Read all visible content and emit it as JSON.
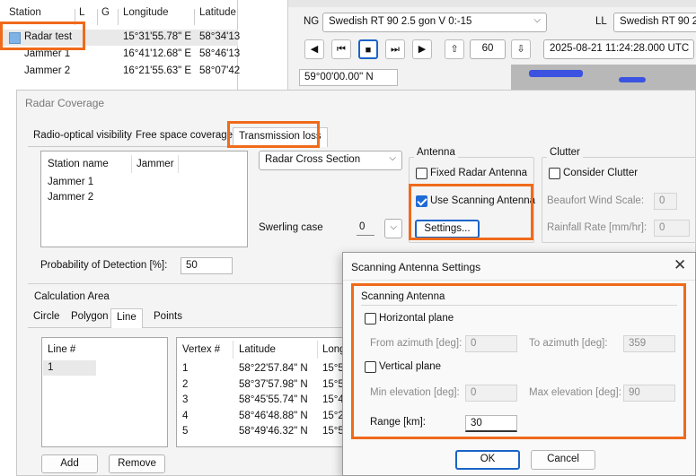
{
  "station_table": {
    "headers": [
      "Station",
      "L",
      "G",
      "Longitude",
      "Latitude"
    ],
    "rows": [
      {
        "name": "Radar test",
        "longitude": "15°31'55.78\" E",
        "latitude": "58°34'13"
      },
      {
        "name": "Jammer 1",
        "longitude": "16°41'12.68\" E",
        "latitude": "58°46'13"
      },
      {
        "name": "Jammer 2",
        "longitude": "16°21'55.63\" E",
        "latitude": "58°07'42"
      }
    ]
  },
  "map_toolbar": {
    "ng_label": "NG",
    "ng_value": "Swedish RT 90 2.5 gon V 0:-15",
    "ll_label": "LL",
    "ll_value": "Swedish RT 90 2.5",
    "step_value": "60",
    "datetime": "2025-08-21 11:24:28.000 UTC",
    "coord_readout": "59°00'00.00\" N"
  },
  "radar_coverage": {
    "title": "Radar Coverage",
    "tabs": [
      "Radio-optical visibility",
      "Free space coverage",
      "Transmission loss"
    ],
    "station_list_headers": [
      "Station name",
      "Jammer"
    ],
    "station_list_items": [
      "Jammer 1",
      "Jammer 2"
    ],
    "rcs_select": "Radar Cross Section",
    "swerling_label": "Swerling case",
    "swerling_value": "0",
    "pod_label": "Probability of Detection [%]:",
    "pod_value": "50",
    "antenna": {
      "title": "Antenna",
      "fixed_label": "Fixed Radar Antenna",
      "scanning_label": "Use Scanning Antenna",
      "settings_label": "Settings..."
    },
    "clutter": {
      "title": "Clutter",
      "consider_label": "Consider Clutter",
      "beaufort_label": "Beaufort Wind Scale:",
      "beaufort_value": "0",
      "rainfall_label": "Rainfall Rate [mm/hr]:",
      "rainfall_value": "0"
    },
    "calc_area": {
      "title": "Calculation Area",
      "tabs": [
        "Circle",
        "Polygon",
        "Line",
        "Points"
      ],
      "line_header": "Line #",
      "line_items": [
        "1"
      ],
      "vertex_headers": [
        "Vertex #",
        "Latitude",
        "Long"
      ],
      "vertices": [
        {
          "n": "1",
          "lat": "58°22'57.84\" N",
          "lon": "15°5"
        },
        {
          "n": "2",
          "lat": "58°37'57.98\" N",
          "lon": "15°5"
        },
        {
          "n": "3",
          "lat": "58°45'55.74\" N",
          "lon": "15°4"
        },
        {
          "n": "4",
          "lat": "58°46'48.88\" N",
          "lon": "15°2"
        },
        {
          "n": "5",
          "lat": "58°49'46.32\" N",
          "lon": "15°5"
        }
      ],
      "add_label": "Add",
      "remove_label": "Remove"
    }
  },
  "scan_dialog": {
    "title": "Scanning Antenna Settings",
    "group_title": "Scanning Antenna",
    "horizontal_label": "Horizontal plane",
    "from_az_label": "From azimuth [deg]:",
    "from_az_value": "0",
    "to_az_label": "To azimuth [deg]:",
    "to_az_value": "359",
    "vertical_label": "Vertical plane",
    "min_el_label": "Min elevation [deg]:",
    "min_el_value": "0",
    "max_el_label": "Max elevation [deg]:",
    "max_el_value": "90",
    "range_label": "Range [km]:",
    "range_value": "30",
    "ok_label": "OK",
    "cancel_label": "Cancel"
  },
  "colors": {
    "highlight": "#f06a1b",
    "accent": "#1e6bd6",
    "station_icon": "#7fb2e5"
  }
}
